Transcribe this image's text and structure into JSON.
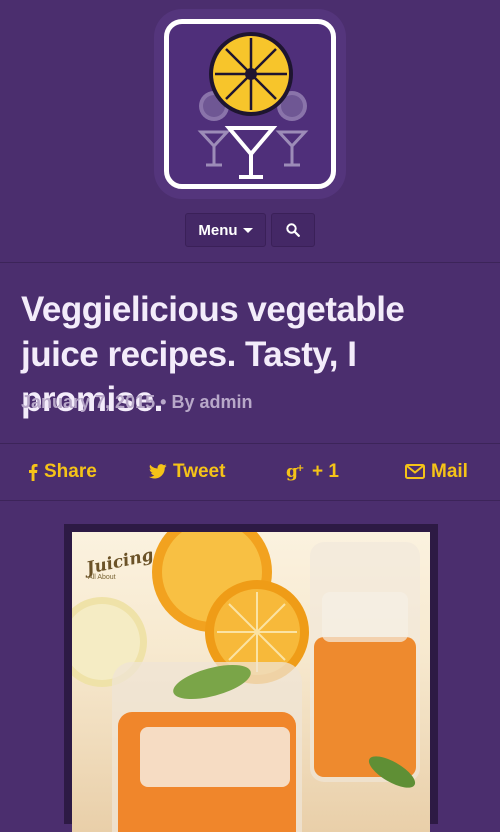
{
  "header": {
    "logo_alt": "juice site logo",
    "menu_label": "Menu",
    "search_icon": "search-icon"
  },
  "post": {
    "title": "Veggielicious vegetable juice recipes. Tasty, I promise.",
    "date": "January 7, 2015",
    "separator": "•",
    "by_prefix": "By",
    "author": "admin"
  },
  "share": {
    "facebook_label": "Share",
    "twitter_label": "Tweet",
    "gplus_label": "+ 1",
    "mail_label": "Mail"
  },
  "image": {
    "watermark_text": "Juicing",
    "watermark_top": "All About"
  },
  "colors": {
    "background": "#4b2e6e",
    "accent": "#f5c318",
    "title": "#f3ecfa",
    "meta": "#b8a8c9"
  }
}
